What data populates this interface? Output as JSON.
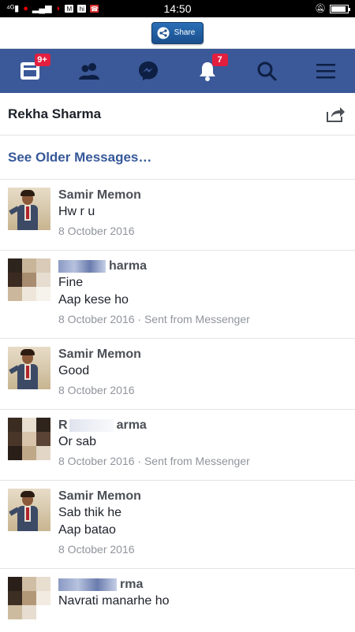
{
  "statusbar": {
    "left_icons": [
      "signal-4g",
      "vodafone",
      "signal-bars",
      "airtel",
      "gmail",
      "hike",
      "missed-call"
    ],
    "time": "14:50",
    "right_icons": [
      "silent-bell",
      "battery"
    ],
    "battery_level": 0.9
  },
  "share": {
    "label": "Share"
  },
  "nav": {
    "items": [
      {
        "name": "news-feed",
        "badge": "9+"
      },
      {
        "name": "friends",
        "badge": ""
      },
      {
        "name": "messenger",
        "badge": ""
      },
      {
        "name": "notifications",
        "badge": "7"
      },
      {
        "name": "search",
        "badge": ""
      },
      {
        "name": "menu",
        "badge": ""
      }
    ]
  },
  "thread": {
    "title": "Rekha Sharma",
    "older_link": "See Older Messages…"
  },
  "messages": [
    {
      "sender": "Samir Memon",
      "lines": [
        "Hw r u"
      ],
      "meta": "8 October 2016"
    },
    {
      "sender": "harma",
      "lines": [
        "Fine",
        "Aap kese ho"
      ],
      "meta": "8 October 2016 · Sent from Messenger"
    },
    {
      "sender": "Samir Memon",
      "lines": [
        "Good"
      ],
      "meta": "8 October 2016"
    },
    {
      "sender": "R",
      "sender_tail": "arma",
      "lines": [
        "Or sab"
      ],
      "meta": "8 October 2016 · Sent from Messenger"
    },
    {
      "sender": "Samir Memon",
      "lines": [
        "Sab thik he",
        "Aap batao"
      ],
      "meta": "8 October 2016"
    },
    {
      "sender": "rma",
      "lines": [
        "Navrati manarhe ho"
      ],
      "meta": ""
    }
  ],
  "colors": {
    "nav_bg": "#3b5998",
    "link": "#365899",
    "badge": "#e41e3f"
  }
}
